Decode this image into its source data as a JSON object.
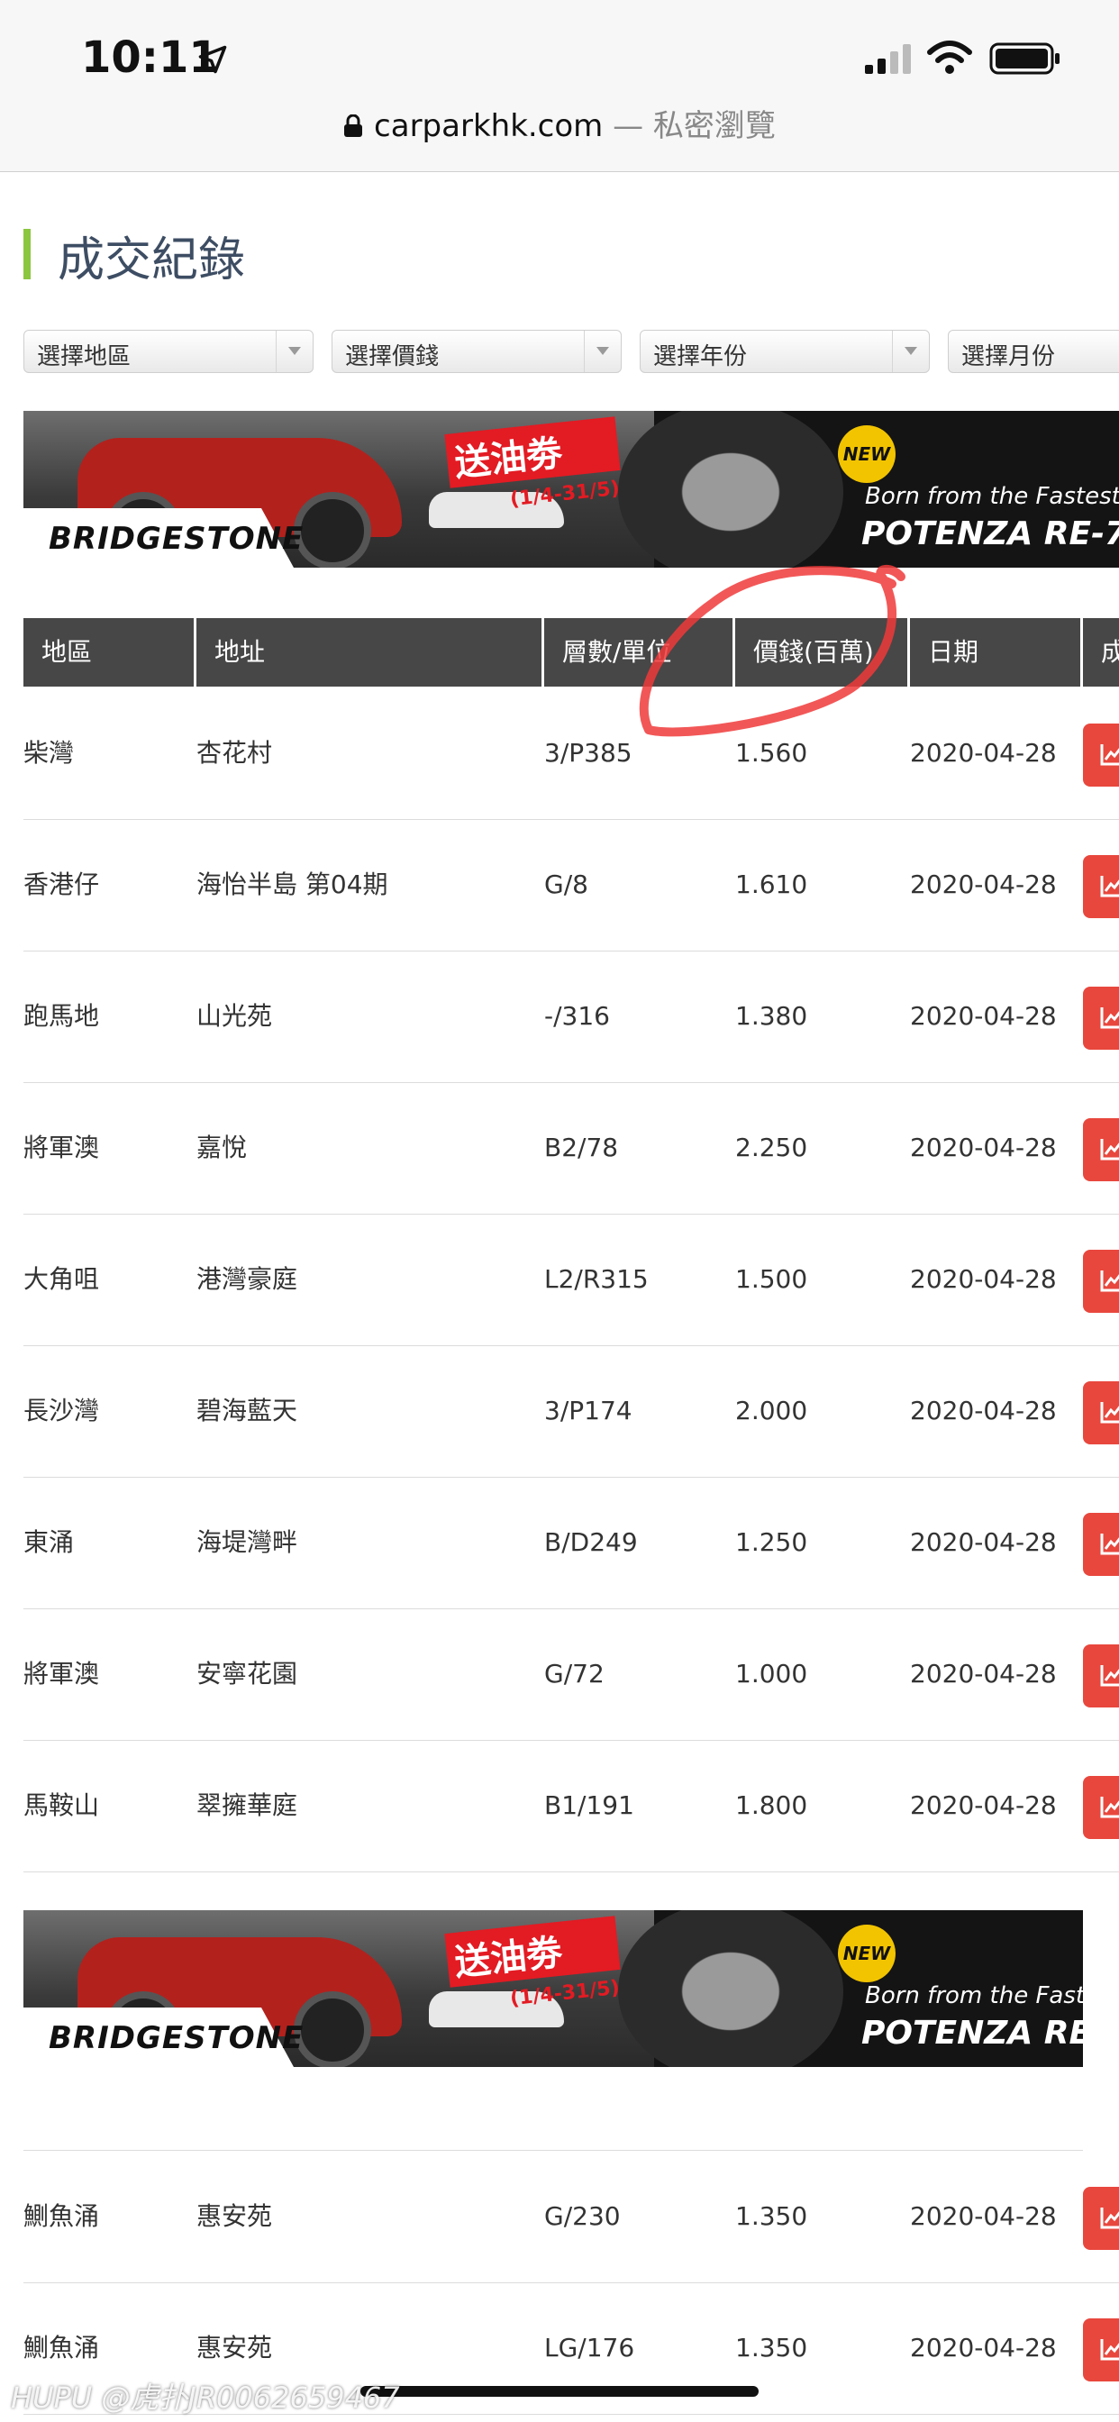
{
  "status_bar": {
    "time": "10:11"
  },
  "browser": {
    "domain": "carparkhk.com",
    "mode": " — 私密瀏覽"
  },
  "page": {
    "title": "成交紀錄"
  },
  "filters": [
    {
      "label": "選擇地區"
    },
    {
      "label": "選擇價錢"
    },
    {
      "label": "選擇年份"
    },
    {
      "label": "選擇月份"
    }
  ],
  "ad": {
    "brand": "BRIDGESTONE",
    "promo": "送油劵",
    "promo_date": "(1/4-31/5)",
    "badge": "NEW",
    "tagline": "Born from the Fastest",
    "product": "POTENZA RE-7"
  },
  "table": {
    "columns": [
      "地區",
      "地址",
      "層數/單位",
      "價錢(百萬)",
      "日期",
      "成"
    ],
    "rows": [
      {
        "district": "柴灣",
        "address": "杏花村",
        "unit": "3/P385",
        "price": "1.560",
        "date": "2020-04-28"
      },
      {
        "district": "香港仔",
        "address": "海怡半島 第04期",
        "unit": "G/8",
        "price": "1.610",
        "date": "2020-04-28"
      },
      {
        "district": "跑馬地",
        "address": "山光苑",
        "unit": "-/316",
        "price": "1.380",
        "date": "2020-04-28"
      },
      {
        "district": "將軍澳",
        "address": "嘉悅",
        "unit": "B2/78",
        "price": "2.250",
        "date": "2020-04-28"
      },
      {
        "district": "大角咀",
        "address": "港灣豪庭",
        "unit": "L2/R315",
        "price": "1.500",
        "date": "2020-04-28"
      },
      {
        "district": "長沙灣",
        "address": "碧海藍天",
        "unit": "3/P174",
        "price": "2.000",
        "date": "2020-04-28"
      },
      {
        "district": "東涌",
        "address": "海堤灣畔",
        "unit": "B/D249",
        "price": "1.250",
        "date": "2020-04-28"
      },
      {
        "district": "將軍澳",
        "address": "安寧花園",
        "unit": "G/72",
        "price": "1.000",
        "date": "2020-04-28"
      },
      {
        "district": "馬鞍山",
        "address": "翠擁華庭",
        "unit": "B1/191",
        "price": "1.800",
        "date": "2020-04-28"
      }
    ],
    "rows_after_ad": [
      {
        "district": "鰂魚涌",
        "address": "惠安苑",
        "unit": "G/230",
        "price": "1.350",
        "date": "2020-04-28"
      },
      {
        "district": "鰂魚涌",
        "address": "惠安苑",
        "unit": "LG/176",
        "price": "1.350",
        "date": "2020-04-28"
      }
    ]
  },
  "watermark": "HUPU @虎扑JR0062659467",
  "colors": {
    "accent_green": "#8cc63f",
    "header_bg": "#474747",
    "action_red": "#e8473d",
    "annotation": "#f03a3a"
  }
}
